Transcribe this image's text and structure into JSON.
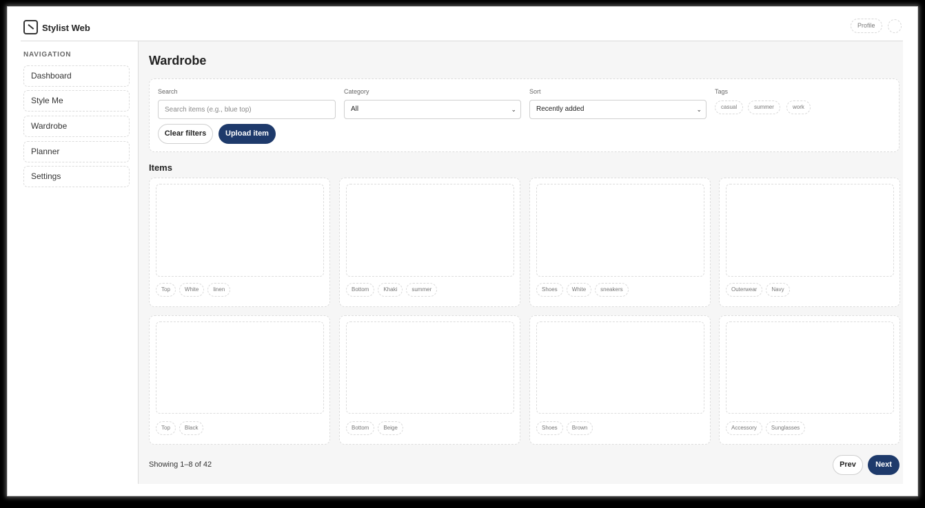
{
  "app": {
    "title": "Stylist Web",
    "logo_icon": "app-logo-icon"
  },
  "header": {
    "profile_label": "Profile"
  },
  "sidebar": {
    "heading": "NAVIGATION",
    "items": [
      {
        "label": "Dashboard"
      },
      {
        "label": "Style Me"
      },
      {
        "label": "Wardrobe",
        "active": true
      },
      {
        "label": "Planner"
      },
      {
        "label": "Settings"
      }
    ]
  },
  "page": {
    "title": "Wardrobe"
  },
  "filters": {
    "search_label": "Search",
    "search_placeholder": "Search items (e.g., blue top)",
    "search_value": "",
    "category_label": "Category",
    "category_value": "All",
    "sort_label": "Sort",
    "sort_value": "Recently added",
    "tags_label": "Tags",
    "tags": [
      "casual",
      "summer",
      "work"
    ],
    "clear_label": "Clear filters",
    "upload_label": "Upload item"
  },
  "items_heading": "Items",
  "items": [
    {
      "tags": [
        "Top",
        "White",
        "linen"
      ]
    },
    {
      "tags": [
        "Bottom",
        "Khaki",
        "summer"
      ]
    },
    {
      "tags": [
        "Shoes",
        "White",
        "sneakers"
      ]
    },
    {
      "tags": [
        "Outerwear",
        "Navy"
      ]
    },
    {
      "tags": [
        "Top",
        "Black"
      ]
    },
    {
      "tags": [
        "Bottom",
        "Beige"
      ]
    },
    {
      "tags": [
        "Shoes",
        "Brown"
      ]
    },
    {
      "tags": [
        "Accessory",
        "Sunglasses"
      ]
    }
  ],
  "pagination": {
    "showing_text": "Showing 1–8 of 42",
    "prev_label": "Prev",
    "next_label": "Next"
  },
  "colors": {
    "primary": "#1e3a6b",
    "main_bg": "#f6f6f6",
    "border": "#dcdcdc"
  }
}
